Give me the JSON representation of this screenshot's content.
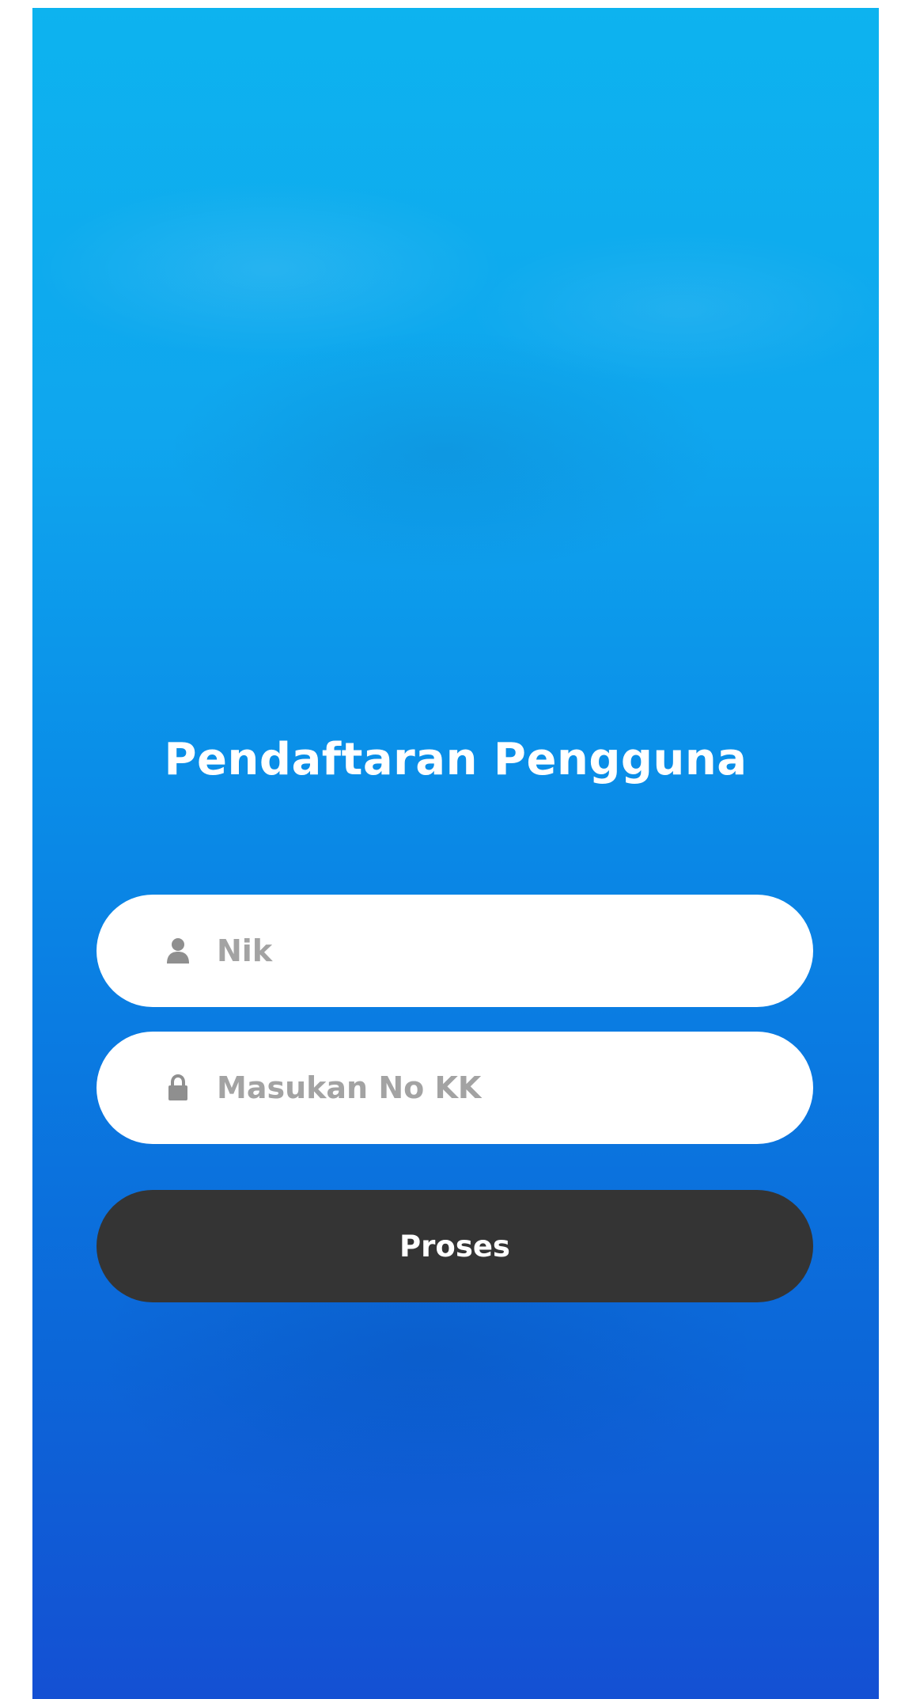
{
  "page": {
    "title": "Pendaftaran Pengguna"
  },
  "form": {
    "nik": {
      "placeholder": "Nik",
      "value": "",
      "icon": "user-icon"
    },
    "kk": {
      "placeholder": "Masukan No KK",
      "value": "",
      "icon": "lock-icon"
    },
    "submit_label": "Proses"
  },
  "colors": {
    "background_top": "#0db3ef",
    "background_bottom": "#1450d3",
    "button": "#343434",
    "field": "#ffffff",
    "placeholder": "#a3a3a3"
  }
}
